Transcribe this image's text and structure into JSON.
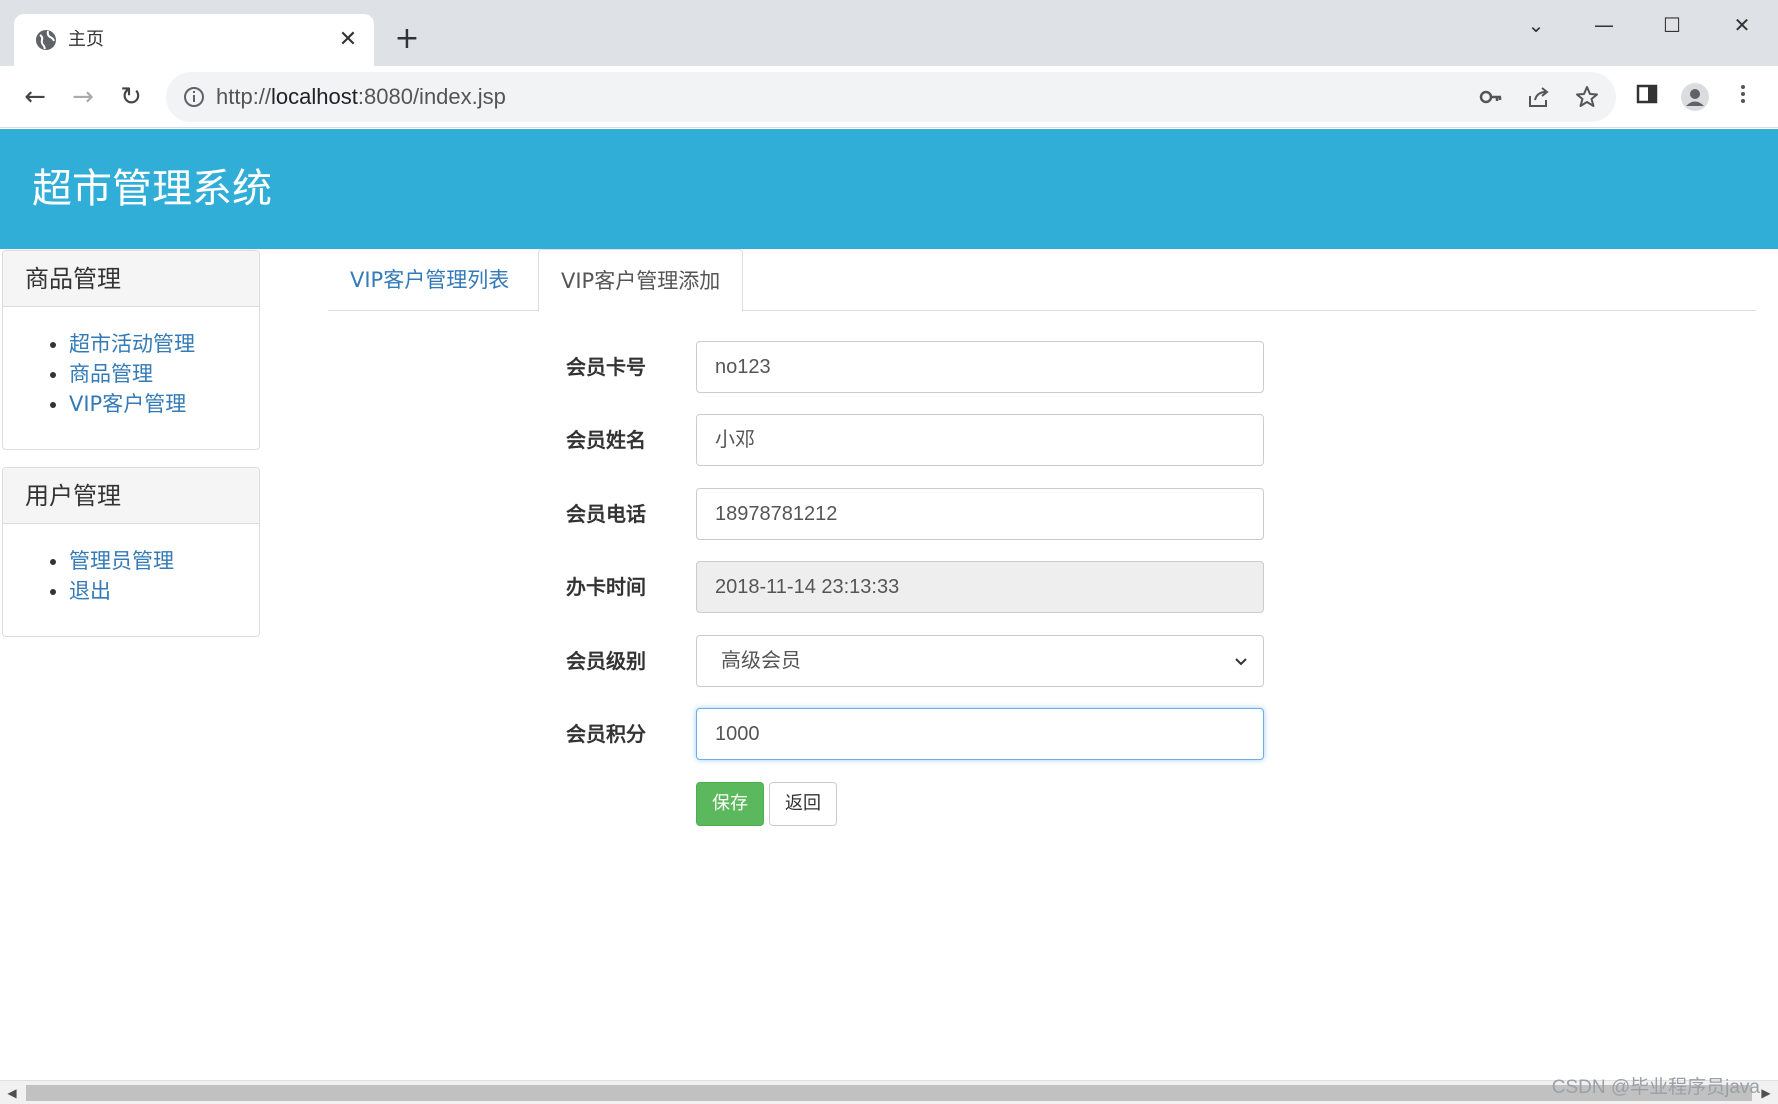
{
  "browser": {
    "tab_title": "主页",
    "tab_close": "✕",
    "new_tab": "+",
    "url_scheme": "http://",
    "url_host": "localhost",
    "url_rest": ":8080/index.jsp",
    "window_buttons": {
      "dropdown": "⌄",
      "minimize": "—",
      "maximize": "☐",
      "close": "✕"
    },
    "nav": {
      "back": "←",
      "forward": "→",
      "reload": "↻"
    },
    "icons": [
      "key-icon",
      "share-icon",
      "star-icon",
      "sidepanel-icon",
      "profile-icon",
      "menu-icon"
    ]
  },
  "app": {
    "title": "超市管理系统",
    "header_color": "#31aed7"
  },
  "sidebar": {
    "panels": [
      {
        "heading": "商品管理",
        "items": [
          "超市活动管理",
          "商品管理",
          "VIP客户管理"
        ]
      },
      {
        "heading": "用户管理",
        "items": [
          "管理员管理",
          "退出"
        ]
      }
    ]
  },
  "tabs": [
    {
      "label": "VIP客户管理列表",
      "active": false
    },
    {
      "label": "VIP客户管理添加",
      "active": true
    }
  ],
  "form": {
    "card_no": {
      "label": "会员卡号",
      "value": "no123"
    },
    "name": {
      "label": "会员姓名",
      "value": "小邓"
    },
    "phone": {
      "label": "会员电话",
      "value": "18978781212"
    },
    "issue_time": {
      "label": "办卡时间",
      "value": "2018-11-14 23:13:33"
    },
    "level": {
      "label": "会员级别",
      "value": "高级会员"
    },
    "points": {
      "label": "会员积分",
      "value": "1000"
    },
    "save_label": "保存",
    "back_label": "返回"
  },
  "watermark": "CSDN @毕业程序员java",
  "colors": {
    "link": "#337ab7",
    "save_button": "#5cb85c"
  }
}
